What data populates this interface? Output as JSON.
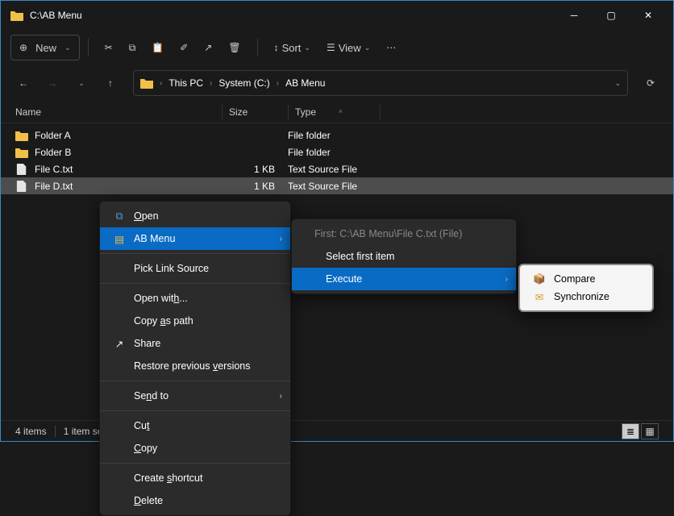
{
  "title": "C:\\AB Menu",
  "toolbar": {
    "new_label": "New",
    "sort_label": "Sort",
    "view_label": "View"
  },
  "breadcrumbs": [
    "This PC",
    "System (C:)",
    "AB Menu"
  ],
  "columns": {
    "name": "Name",
    "size": "Size",
    "type": "Type"
  },
  "files": [
    {
      "name": "Folder A",
      "size": "",
      "type": "File folder",
      "kind": "folder"
    },
    {
      "name": "Folder B",
      "size": "",
      "type": "File folder",
      "kind": "folder"
    },
    {
      "name": "File C.txt",
      "size": "1 KB",
      "type": "Text Source File",
      "kind": "file"
    },
    {
      "name": "File D.txt",
      "size": "1 KB",
      "type": "Text Source File",
      "kind": "file",
      "selected": true
    }
  ],
  "status": {
    "items": "4 items",
    "selected": "1 item se"
  },
  "context_main": {
    "open": "Open",
    "ab_menu": "AB Menu",
    "pick_link": "Pick Link Source",
    "open_with": "Open with...",
    "copy_as_path": "Copy as path",
    "share": "Share",
    "restore": "Restore previous versions",
    "send_to": "Send to",
    "cut": "Cut",
    "copy": "Copy",
    "create_shortcut": "Create shortcut",
    "delete": "Delete"
  },
  "context_sub": {
    "first_header": "First: C:\\AB Menu\\File C.txt (File)",
    "select_first": "Select first item",
    "execute": "Execute"
  },
  "context_sub2": {
    "compare": "Compare",
    "synchronize": "Synchronize"
  }
}
